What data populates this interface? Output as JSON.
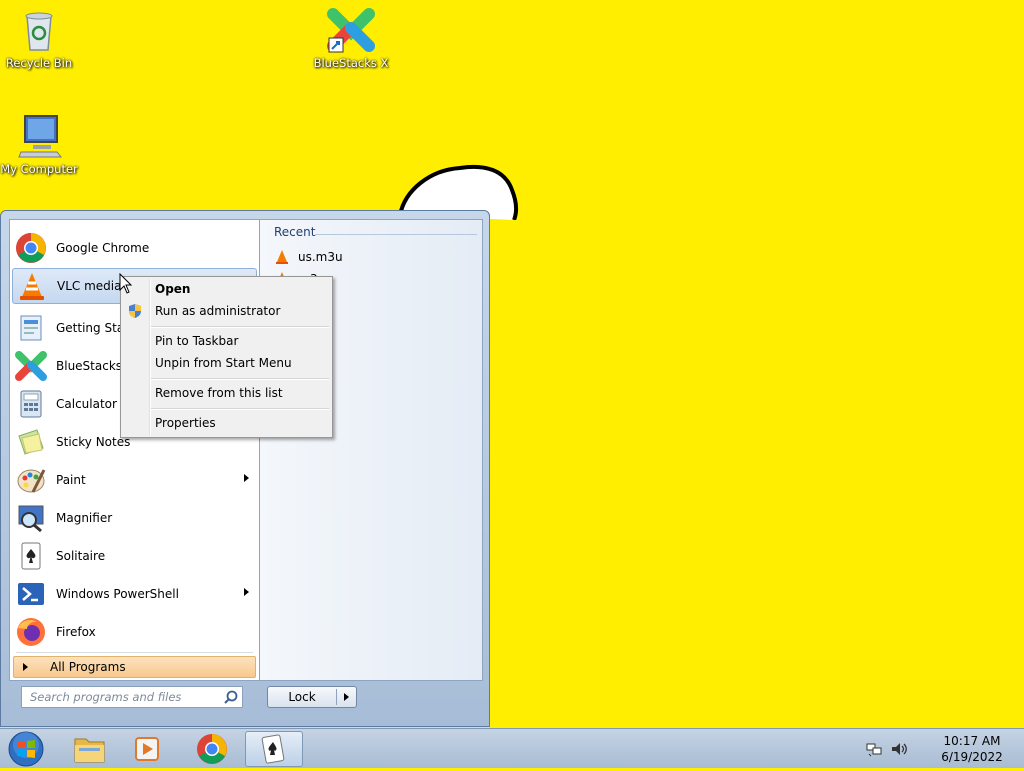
{
  "desktop": {
    "background_color": "#ffee00",
    "icons": [
      {
        "label": "Recycle Bin",
        "icon": "recycle-bin-icon"
      },
      {
        "label": "BlueStacks X",
        "icon": "bluestacks-icon"
      },
      {
        "label": "My Computer",
        "icon": "computer-icon"
      }
    ]
  },
  "start_menu": {
    "programs": [
      {
        "label": "Google Chrome",
        "icon": "chrome-icon"
      },
      {
        "label": "VLC media pl",
        "icon": "vlc-icon"
      },
      {
        "label": "Getting Starte",
        "icon": "getting-started-icon"
      },
      {
        "label": "BlueStacks X",
        "icon": "bluestacks-icon"
      },
      {
        "label": "Calculator",
        "icon": "calculator-icon"
      },
      {
        "label": "Sticky Notes",
        "icon": "sticky-notes-icon"
      },
      {
        "label": "Paint",
        "icon": "paint-icon"
      },
      {
        "label": "Magnifier",
        "icon": "magnifier-icon"
      },
      {
        "label": "Solitaire",
        "icon": "solitaire-icon"
      },
      {
        "label": "Windows PowerShell",
        "icon": "powershell-icon"
      },
      {
        "label": "Firefox",
        "icon": "firefox-icon"
      }
    ],
    "all_programs_label": "All Programs",
    "search_placeholder": "Search programs and files",
    "lock_label": "Lock",
    "recent_header": "Recent",
    "recent_items": [
      "us.m3u",
      "…3u"
    ]
  },
  "context_menu": {
    "open": "Open",
    "run_as_admin": "Run as administrator",
    "pin_taskbar": "Pin to Taskbar",
    "unpin_start": "Unpin from Start Menu",
    "remove_list": "Remove from this list",
    "properties": "Properties"
  },
  "taskbar": {
    "time": "10:17 AM",
    "date": "6/19/2022"
  }
}
